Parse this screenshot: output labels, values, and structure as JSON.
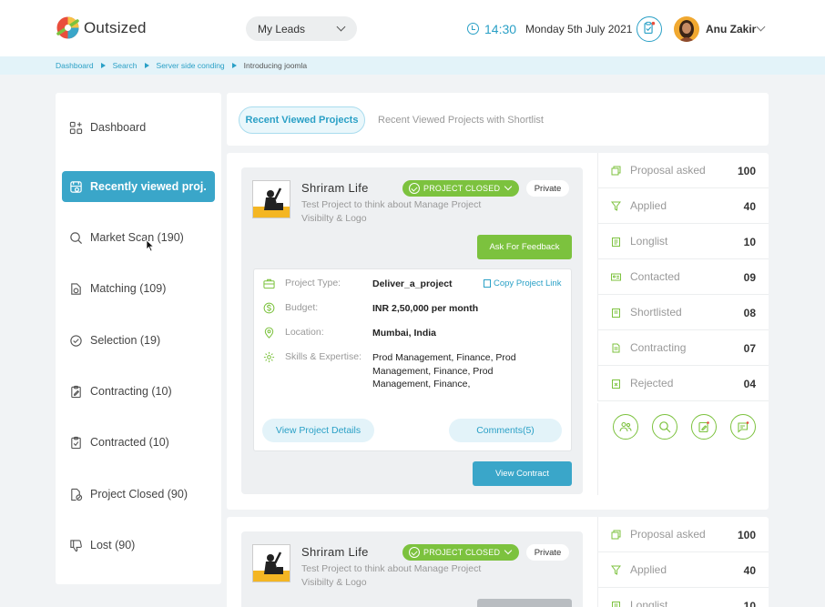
{
  "app": {
    "name": "Outsized"
  },
  "header": {
    "selector_value": "My Leads",
    "time": "14:30",
    "date": "Monday 5th July 2021",
    "user_name": "Anu Zakir"
  },
  "breadcrumb": [
    {
      "label": "Dashboard"
    },
    {
      "label": "Search"
    },
    {
      "label": "Server side conding"
    },
    {
      "label": "Introducing joomla"
    }
  ],
  "sidebar": {
    "items": [
      {
        "label": "Dashboard",
        "icon": "dashboard-icon"
      },
      {
        "label": "Recently viewed proj.",
        "icon": "recent-icon"
      },
      {
        "label": "Market Scan (190)",
        "icon": "search-icon"
      },
      {
        "label": "Matching (109)",
        "icon": "matching-icon"
      },
      {
        "label": "Selection (19)",
        "icon": "check-circle-icon"
      },
      {
        "label": "Contracting (10)",
        "icon": "clipboard-edit-icon"
      },
      {
        "label": "Contracted (10)",
        "icon": "clipboard-check-icon"
      },
      {
        "label": "Project Closed (90)",
        "icon": "document-closed-icon"
      },
      {
        "label": "Lost (90)",
        "icon": "thumbs-down-icon"
      }
    ]
  },
  "tabs": [
    {
      "label": "Recent Viewed Projects"
    },
    {
      "label": "Recent Viewed Projects with Shortlist"
    }
  ],
  "projects": [
    {
      "company": "Shriram Life",
      "status": "PROJECT CLOSED",
      "visibility": "Private",
      "description": "Test Project to think about Manage Project Visibilty & Logo",
      "feedback_label": "Ask For Feedback",
      "copy_link_label": "Copy Project Link",
      "details": [
        {
          "label": "Project Type:",
          "value": "Deliver_a_project"
        },
        {
          "label": "Budget:",
          "value": "INR 2,50,000 per month"
        },
        {
          "label": "Location:",
          "value": "Mumbai, India"
        },
        {
          "label": "Skills & Expertise:",
          "value": "Prod Management, Finance, Prod Management, Finance, Prod Management, Finance,"
        }
      ],
      "view_details_label": "View Project Details",
      "comments_label": "Comments(5)",
      "view_contract_label": "View Contract",
      "stats": [
        {
          "label": "Proposal asked",
          "value": "100"
        },
        {
          "label": "Applied",
          "value": "40"
        },
        {
          "label": "Longlist",
          "value": "10"
        },
        {
          "label": "Contacted",
          "value": "09"
        },
        {
          "label": "Shortlisted",
          "value": "08"
        },
        {
          "label": "Contracting",
          "value": "07"
        },
        {
          "label": "Rejected",
          "value": "04"
        }
      ]
    },
    {
      "company": "Shriram Life",
      "status": "PROJECT CLOSED",
      "visibility": "Private",
      "description": "Test Project to think about Manage Project Visibilty & Logo",
      "stats": [
        {
          "label": "Proposal asked",
          "value": "100"
        },
        {
          "label": "Applied",
          "value": "40"
        },
        {
          "label": "Longlist",
          "value": "10"
        }
      ]
    }
  ]
}
